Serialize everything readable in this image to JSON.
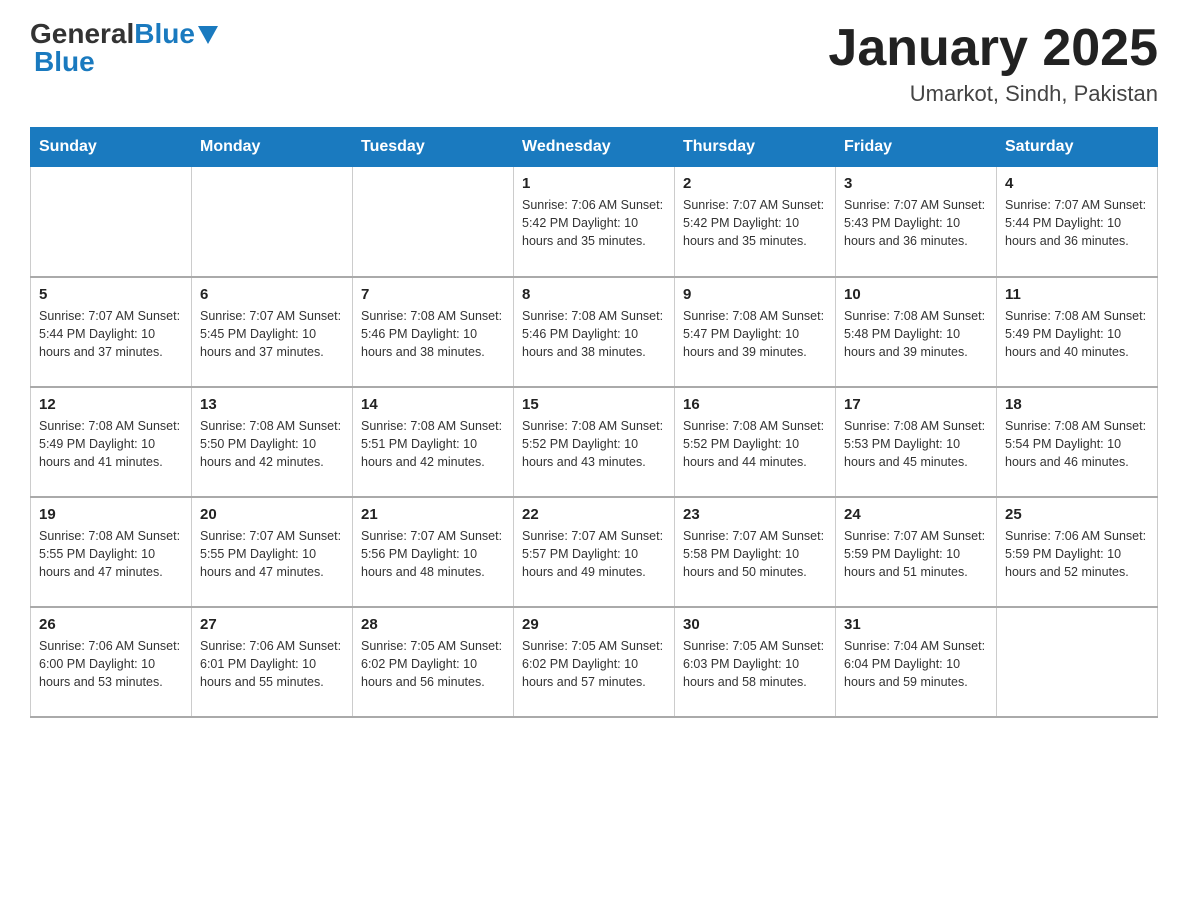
{
  "logo": {
    "general": "General",
    "blue": "Blue",
    "triangle": "▼"
  },
  "title": "January 2025",
  "subtitle": "Umarkot, Sindh, Pakistan",
  "days_of_week": [
    "Sunday",
    "Monday",
    "Tuesday",
    "Wednesday",
    "Thursday",
    "Friday",
    "Saturday"
  ],
  "weeks": [
    [
      {
        "day": "",
        "info": ""
      },
      {
        "day": "",
        "info": ""
      },
      {
        "day": "",
        "info": ""
      },
      {
        "day": "1",
        "info": "Sunrise: 7:06 AM\nSunset: 5:42 PM\nDaylight: 10 hours and 35 minutes."
      },
      {
        "day": "2",
        "info": "Sunrise: 7:07 AM\nSunset: 5:42 PM\nDaylight: 10 hours and 35 minutes."
      },
      {
        "day": "3",
        "info": "Sunrise: 7:07 AM\nSunset: 5:43 PM\nDaylight: 10 hours and 36 minutes."
      },
      {
        "day": "4",
        "info": "Sunrise: 7:07 AM\nSunset: 5:44 PM\nDaylight: 10 hours and 36 minutes."
      }
    ],
    [
      {
        "day": "5",
        "info": "Sunrise: 7:07 AM\nSunset: 5:44 PM\nDaylight: 10 hours and 37 minutes."
      },
      {
        "day": "6",
        "info": "Sunrise: 7:07 AM\nSunset: 5:45 PM\nDaylight: 10 hours and 37 minutes."
      },
      {
        "day": "7",
        "info": "Sunrise: 7:08 AM\nSunset: 5:46 PM\nDaylight: 10 hours and 38 minutes."
      },
      {
        "day": "8",
        "info": "Sunrise: 7:08 AM\nSunset: 5:46 PM\nDaylight: 10 hours and 38 minutes."
      },
      {
        "day": "9",
        "info": "Sunrise: 7:08 AM\nSunset: 5:47 PM\nDaylight: 10 hours and 39 minutes."
      },
      {
        "day": "10",
        "info": "Sunrise: 7:08 AM\nSunset: 5:48 PM\nDaylight: 10 hours and 39 minutes."
      },
      {
        "day": "11",
        "info": "Sunrise: 7:08 AM\nSunset: 5:49 PM\nDaylight: 10 hours and 40 minutes."
      }
    ],
    [
      {
        "day": "12",
        "info": "Sunrise: 7:08 AM\nSunset: 5:49 PM\nDaylight: 10 hours and 41 minutes."
      },
      {
        "day": "13",
        "info": "Sunrise: 7:08 AM\nSunset: 5:50 PM\nDaylight: 10 hours and 42 minutes."
      },
      {
        "day": "14",
        "info": "Sunrise: 7:08 AM\nSunset: 5:51 PM\nDaylight: 10 hours and 42 minutes."
      },
      {
        "day": "15",
        "info": "Sunrise: 7:08 AM\nSunset: 5:52 PM\nDaylight: 10 hours and 43 minutes."
      },
      {
        "day": "16",
        "info": "Sunrise: 7:08 AM\nSunset: 5:52 PM\nDaylight: 10 hours and 44 minutes."
      },
      {
        "day": "17",
        "info": "Sunrise: 7:08 AM\nSunset: 5:53 PM\nDaylight: 10 hours and 45 minutes."
      },
      {
        "day": "18",
        "info": "Sunrise: 7:08 AM\nSunset: 5:54 PM\nDaylight: 10 hours and 46 minutes."
      }
    ],
    [
      {
        "day": "19",
        "info": "Sunrise: 7:08 AM\nSunset: 5:55 PM\nDaylight: 10 hours and 47 minutes."
      },
      {
        "day": "20",
        "info": "Sunrise: 7:07 AM\nSunset: 5:55 PM\nDaylight: 10 hours and 47 minutes."
      },
      {
        "day": "21",
        "info": "Sunrise: 7:07 AM\nSunset: 5:56 PM\nDaylight: 10 hours and 48 minutes."
      },
      {
        "day": "22",
        "info": "Sunrise: 7:07 AM\nSunset: 5:57 PM\nDaylight: 10 hours and 49 minutes."
      },
      {
        "day": "23",
        "info": "Sunrise: 7:07 AM\nSunset: 5:58 PM\nDaylight: 10 hours and 50 minutes."
      },
      {
        "day": "24",
        "info": "Sunrise: 7:07 AM\nSunset: 5:59 PM\nDaylight: 10 hours and 51 minutes."
      },
      {
        "day": "25",
        "info": "Sunrise: 7:06 AM\nSunset: 5:59 PM\nDaylight: 10 hours and 52 minutes."
      }
    ],
    [
      {
        "day": "26",
        "info": "Sunrise: 7:06 AM\nSunset: 6:00 PM\nDaylight: 10 hours and 53 minutes."
      },
      {
        "day": "27",
        "info": "Sunrise: 7:06 AM\nSunset: 6:01 PM\nDaylight: 10 hours and 55 minutes."
      },
      {
        "day": "28",
        "info": "Sunrise: 7:05 AM\nSunset: 6:02 PM\nDaylight: 10 hours and 56 minutes."
      },
      {
        "day": "29",
        "info": "Sunrise: 7:05 AM\nSunset: 6:02 PM\nDaylight: 10 hours and 57 minutes."
      },
      {
        "day": "30",
        "info": "Sunrise: 7:05 AM\nSunset: 6:03 PM\nDaylight: 10 hours and 58 minutes."
      },
      {
        "day": "31",
        "info": "Sunrise: 7:04 AM\nSunset: 6:04 PM\nDaylight: 10 hours and 59 minutes."
      },
      {
        "day": "",
        "info": ""
      }
    ]
  ]
}
